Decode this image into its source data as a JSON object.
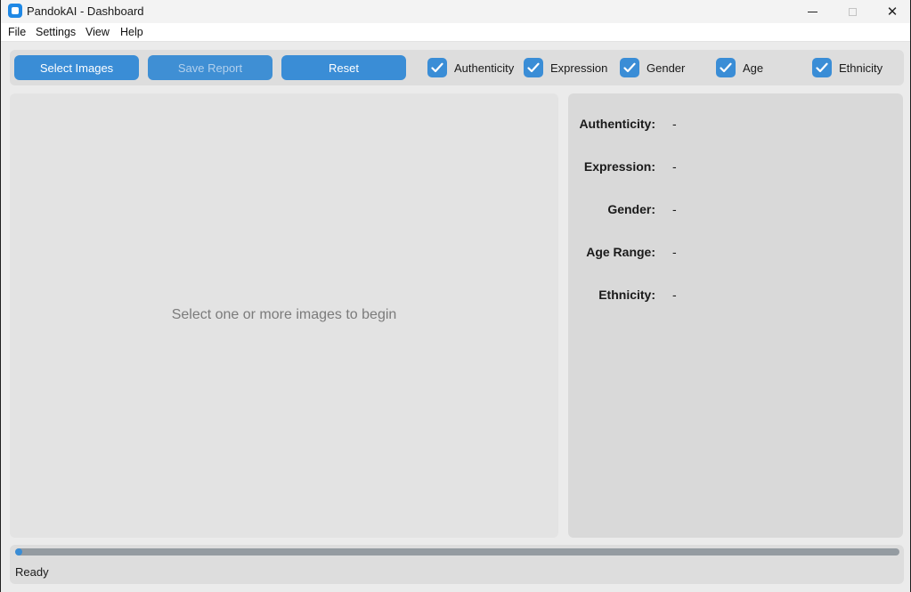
{
  "window": {
    "title": "PandokAI - Dashboard",
    "controls": {
      "minimize": "minimize",
      "maximize": "maximize",
      "close": "✕"
    }
  },
  "menu": [
    "File",
    "Settings",
    "View",
    "Help"
  ],
  "toolbar": {
    "buttons": [
      {
        "label": "Select Images",
        "enabled": true
      },
      {
        "label": "Save Report",
        "enabled": false
      },
      {
        "label": "Reset",
        "enabled": true
      }
    ],
    "checkboxes": [
      {
        "label": "Authenticity",
        "checked": true
      },
      {
        "label": "Expression",
        "checked": true
      },
      {
        "label": "Gender",
        "checked": true
      },
      {
        "label": "Age",
        "checked": true
      },
      {
        "label": "Ethnicity",
        "checked": true
      }
    ]
  },
  "image_panel": {
    "placeholder": "Select one or more images to begin"
  },
  "results": [
    {
      "label": "Authenticity:",
      "value": "-"
    },
    {
      "label": "Expression:",
      "value": "-"
    },
    {
      "label": "Gender:",
      "value": "-"
    },
    {
      "label": "Age Range:",
      "value": "-"
    },
    {
      "label": "Ethnicity:",
      "value": "-"
    }
  ],
  "status": {
    "text": "Ready",
    "progress_fraction": 0.0
  },
  "colors": {
    "accent": "#3a8dd6",
    "progress_track": "#949ba1",
    "panel": "#dddddd"
  },
  "icons": {
    "app": "app-icon",
    "check": "checkmark-icon"
  }
}
